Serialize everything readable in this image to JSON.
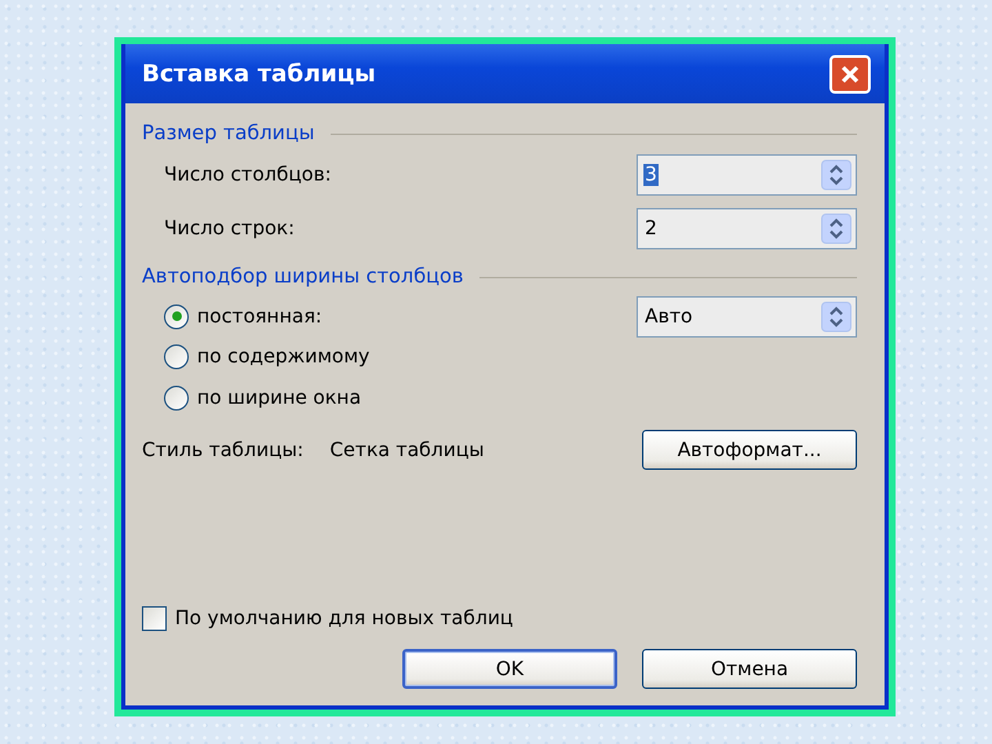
{
  "window": {
    "title": "Вставка таблицы"
  },
  "size_group": {
    "title": "Размер таблицы",
    "fields": [
      {
        "label": "Число столбцов:",
        "value": "3",
        "focused": true
      },
      {
        "label": "Число строк:",
        "value": "2",
        "focused": false
      }
    ]
  },
  "autofit_group": {
    "title": "Автоподбор ширины столбцов",
    "options": [
      {
        "label": "постоянная:",
        "selected": true
      },
      {
        "label": "по содержимому",
        "selected": false
      },
      {
        "label": "по ширине окна",
        "selected": false
      }
    ],
    "width_field": {
      "value": "Авто"
    }
  },
  "style": {
    "label": "Стиль таблицы:",
    "value": "Сетка таблицы",
    "button": "Автоформат..."
  },
  "default_checkbox": {
    "label": "По умолчанию для новых таблиц",
    "checked": false
  },
  "buttons": [
    {
      "label": "OK",
      "default": true
    },
    {
      "label": "Отмена",
      "default": false
    }
  ]
}
